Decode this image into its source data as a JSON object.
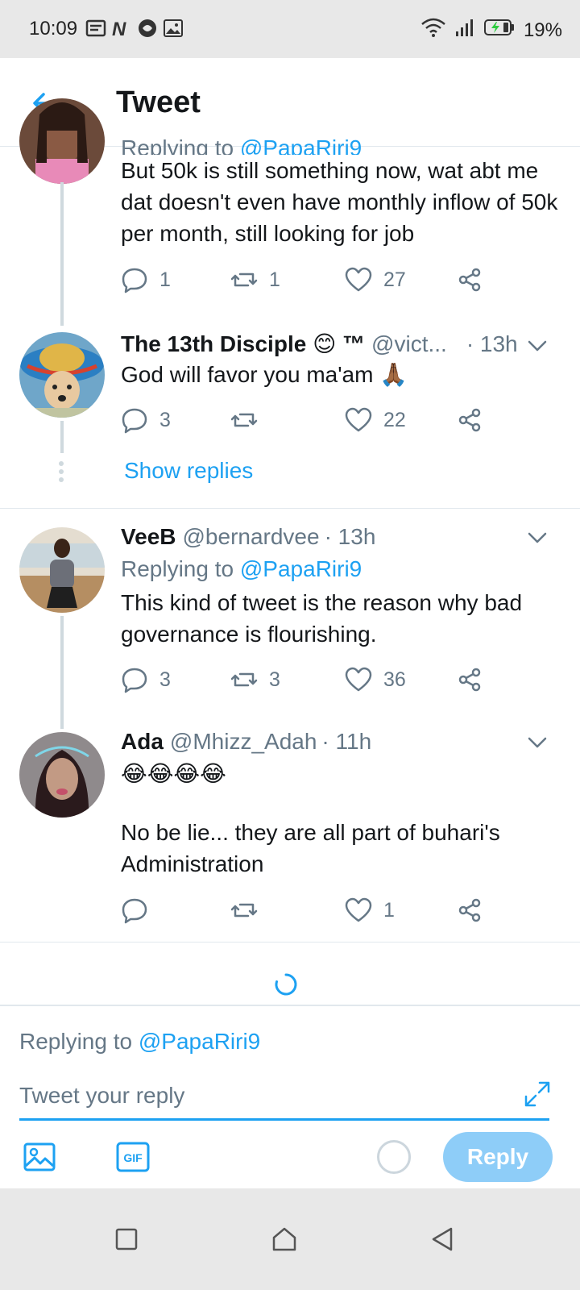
{
  "status_bar": {
    "time": "10:09",
    "battery": "19%",
    "icons": [
      "notification-icon",
      "n-app-icon",
      "app-icon",
      "image-icon",
      "wifi-icon",
      "signal-icon",
      "battery-icon"
    ]
  },
  "header": {
    "title": "Tweet",
    "back_icon": "arrow-left-icon"
  },
  "tweets": [
    {
      "replying_prefix": "Replying to",
      "replying_handle": "@PapaRiri9",
      "text": "But 50k is still something now, wat abt me dat doesn't even have monthly inflow of 50k per month, still looking for job",
      "replies": "1",
      "retweets": "1",
      "likes": "27"
    },
    {
      "name": "The 13th Disciple 😊 ™",
      "handle": "@vict...",
      "time": "· 13h",
      "text": "God will favor you ma'am 🙏🏾",
      "replies": "3",
      "retweets": "",
      "likes": "22",
      "show_replies": "Show replies"
    },
    {
      "name": "VeeB",
      "handle": "@bernardvee",
      "time": "· 13h",
      "replying_prefix": "Replying to",
      "replying_handle": "@PapaRiri9",
      "text": "This kind of tweet is the reason why bad governance is flourishing.",
      "replies": "3",
      "retweets": "3",
      "likes": "36"
    },
    {
      "name": "Ada",
      "handle": "@Mhizz_Adah",
      "time": "· 11h",
      "emoji_line": "😂😂😂😂",
      "text": "No be lie... they are all part of buhari's Administration",
      "replies": "",
      "retweets": "",
      "likes": "1"
    }
  ],
  "composer": {
    "replying_prefix": "Replying to",
    "replying_handle": "@PapaRiri9",
    "placeholder": "Tweet your reply",
    "reply_label": "Reply",
    "gif_label": "GIF"
  },
  "colors": {
    "accent": "#1da1f2",
    "muted": "#657786",
    "text": "#14171a",
    "reply_button_disabled": "#8ecdf8"
  }
}
